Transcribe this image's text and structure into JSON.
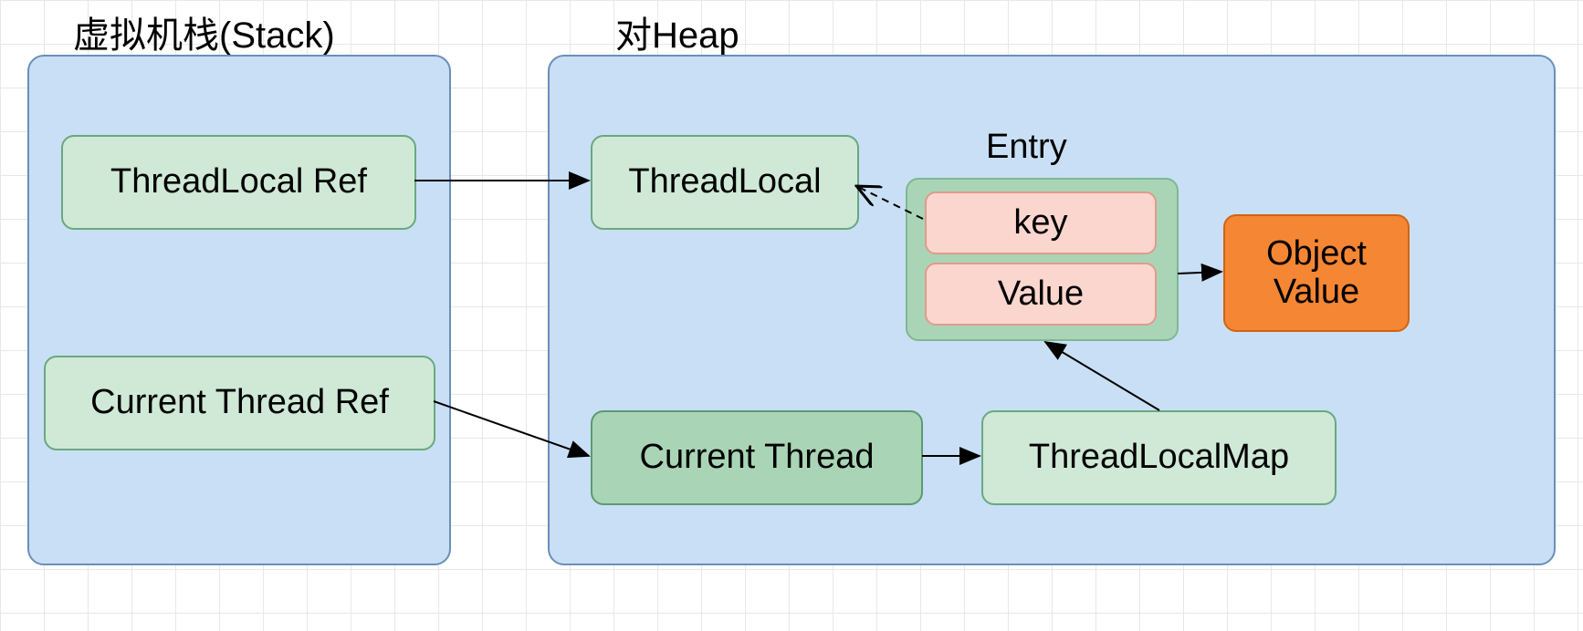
{
  "titles": {
    "stack": "虚拟机栈(Stack)",
    "heap": "对Heap"
  },
  "stack": {
    "threadLocalRef": "ThreadLocal Ref",
    "currentThreadRef": "Current Thread Ref"
  },
  "heap": {
    "threadLocal": "ThreadLocal",
    "currentThread": "Current Thread",
    "threadLocalMap": "ThreadLocalMap",
    "entryLabel": "Entry",
    "entry": {
      "key": "key",
      "value": "Value"
    },
    "objectValue": "Object Value"
  },
  "colors": {
    "containerFill": "#c9dff5",
    "greenLight": "#cfe9d6",
    "greenDark": "#a9d5b6",
    "pink": "#fbd6cf",
    "orange": "#f58634"
  }
}
